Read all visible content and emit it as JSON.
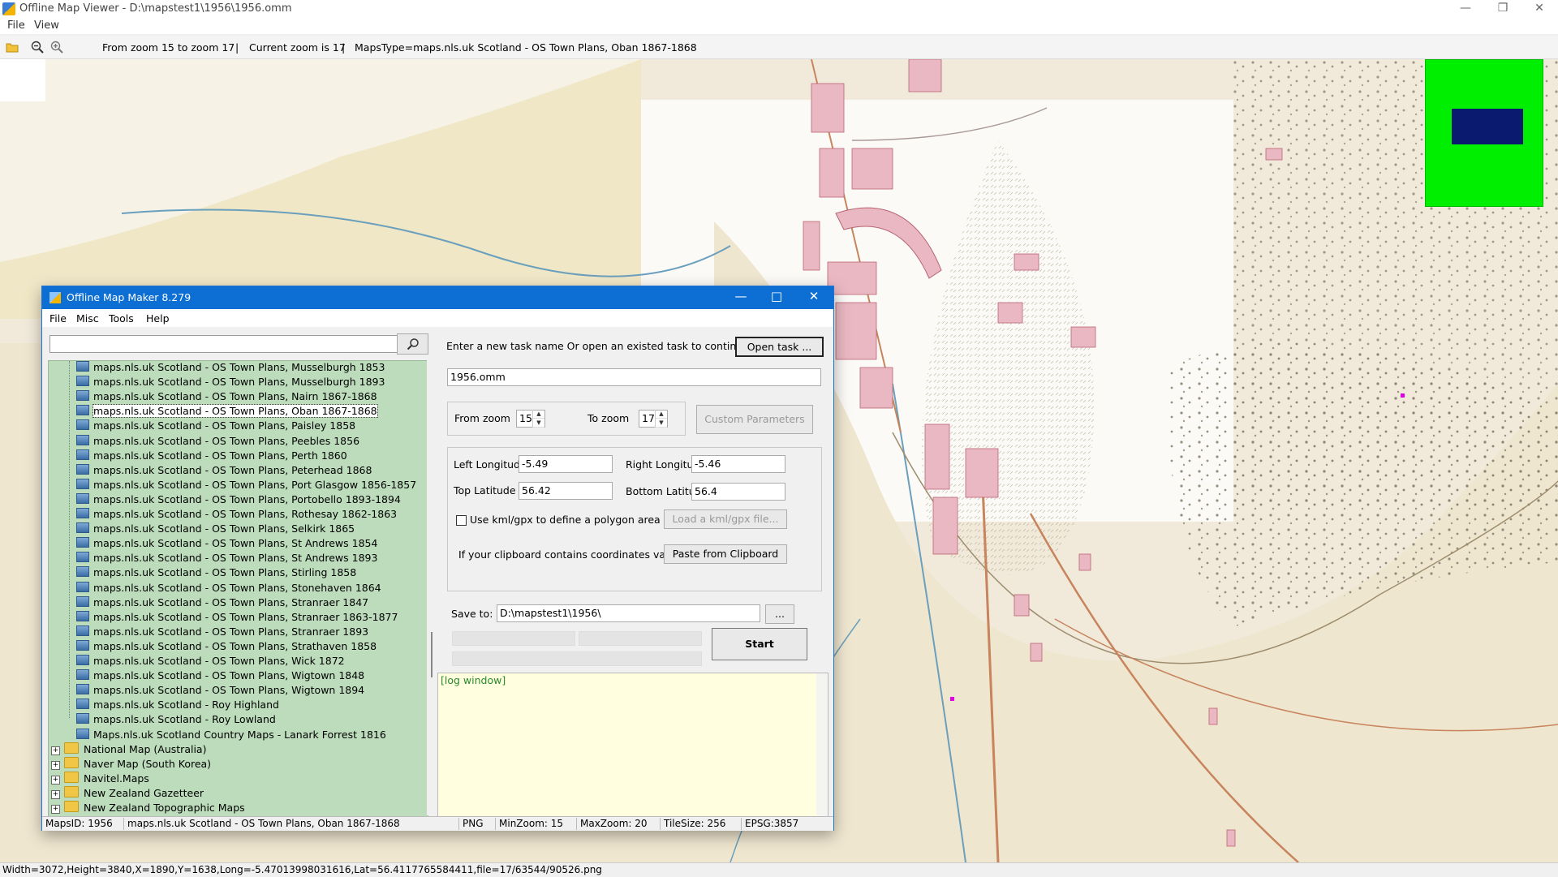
{
  "viewer": {
    "title": "Offline Map Viewer - D:\\mapstest1\\1956\\1956.omm",
    "menu": [
      "File",
      "View"
    ],
    "toolbar": {
      "zoom_range": "From zoom 15 to zoom 17",
      "current_zoom": "Current zoom is 17",
      "maps_type": "MapsType=maps.nls.uk Scotland - OS Town Plans, Oban 1867-1868",
      "separator": "|"
    },
    "status": "Width=3072,Height=3840,X=1890,Y=1638,Long=-5.47013998031616,Lat=56.4117765584411,file=17/63544/90526.png",
    "icons": [
      "open-folder-icon",
      "zoom-out-icon",
      "zoom-in-icon"
    ],
    "colors": {
      "navigator_bg": "#00ee00",
      "navigator_view": "#0a1a6e"
    }
  },
  "dialog": {
    "title": "Offline Map Maker 8.279",
    "menu": [
      "File",
      "Misc",
      "Tools",
      "Help"
    ],
    "search": {
      "value": ""
    },
    "tree": {
      "maps": [
        "maps.nls.uk Scotland - OS Town Plans, Musselburgh 1853",
        "maps.nls.uk Scotland - OS Town Plans, Musselburgh 1893",
        "maps.nls.uk Scotland - OS Town Plans, Nairn 1867-1868",
        "maps.nls.uk Scotland - OS Town Plans, Oban 1867-1868",
        "maps.nls.uk Scotland - OS Town Plans, Paisley 1858",
        "maps.nls.uk Scotland - OS Town Plans, Peebles 1856",
        "maps.nls.uk Scotland - OS Town Plans, Perth 1860",
        "maps.nls.uk Scotland - OS Town Plans, Peterhead 1868",
        "maps.nls.uk Scotland - OS Town Plans, Port Glasgow 1856-1857",
        "maps.nls.uk Scotland - OS Town Plans, Portobello 1893-1894",
        "maps.nls.uk Scotland - OS Town Plans, Rothesay 1862-1863",
        "maps.nls.uk Scotland - OS Town Plans, Selkirk 1865",
        "maps.nls.uk Scotland - OS Town Plans, St Andrews 1854",
        "maps.nls.uk Scotland - OS Town Plans, St Andrews 1893",
        "maps.nls.uk Scotland - OS Town Plans, Stirling 1858",
        "maps.nls.uk Scotland - OS Town Plans, Stonehaven 1864",
        "maps.nls.uk Scotland - OS Town Plans, Stranraer 1847",
        "maps.nls.uk Scotland - OS Town Plans, Stranraer 1863-1877",
        "maps.nls.uk Scotland - OS Town Plans, Stranraer 1893",
        "maps.nls.uk Scotland - OS Town Plans, Strathaven 1858",
        "maps.nls.uk Scotland - OS Town Plans, Wick 1872",
        "maps.nls.uk Scotland - OS Town Plans, Wigtown 1848",
        "maps.nls.uk Scotland - OS Town Plans, Wigtown 1894",
        "maps.nls.uk Scotland - Roy Highland",
        "maps.nls.uk Scotland - Roy Lowland",
        "Maps.nls.uk Scotland Country Maps - Lanark Forrest 1816"
      ],
      "selected_index": 3,
      "folders": [
        "National Map (Australia)",
        "Naver Map (South Korea)",
        "Navitel.Maps",
        "New Zealand Gazetteer",
        "New Zealand Topographic Maps"
      ],
      "expander": "+"
    },
    "task": {
      "prompt": "Enter a new task name Or open an existed task to continue:",
      "open_button": "Open task ...",
      "name": "1956.omm"
    },
    "zoom": {
      "from_label": "From zoom",
      "from_value": "15",
      "to_label": "To zoom",
      "to_value": "17",
      "custom_button": "Custom Parameters"
    },
    "coords": {
      "left_lon_label": "Left Longitude",
      "left_lon": "-5.49",
      "right_lon_label": "Right Longitude",
      "right_lon": "-5.46",
      "top_lat_label": "Top Latitude",
      "top_lat": "56.42",
      "bottom_lat_label": "Bottom Latitude",
      "bottom_lat": "56.4",
      "kml_label": "Use kml/gpx to define a polygon area",
      "kml_button": "Load a kml/gpx file...",
      "clipboard_label": "If your clipboard contains coordinates values:",
      "clipboard_button": "Paste from Clipboard"
    },
    "save": {
      "label": "Save to:",
      "path": "D:\\mapstest1\\1956\\",
      "browse": "..."
    },
    "start_button": "Start",
    "log_label": "[log window]",
    "status": {
      "maps_id": "MapsID: 1956",
      "map_name": "maps.nls.uk Scotland - OS Town Plans, Oban 1867-1868",
      "format": "PNG",
      "min_zoom": "MinZoom: 15",
      "max_zoom": "MaxZoom: 20",
      "tile_size": "TileSize: 256",
      "epsg": "EPSG:3857"
    }
  }
}
